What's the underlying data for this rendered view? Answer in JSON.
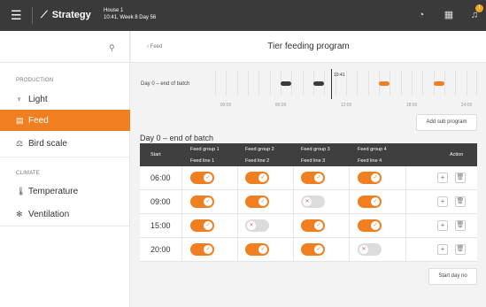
{
  "topbar": {
    "app_title": "Strategy",
    "house_line1": "House 1",
    "house_line2": "10:41, Week 8 Day 56",
    "menu_glyph": "☰",
    "chart_glyph": "⟋",
    "bell_badge": "!"
  },
  "sidebar": {
    "section_production": "PRODUCTION",
    "section_climate": "CLIMATE",
    "items": [
      {
        "label": "Light",
        "icon": "bulb-icon",
        "glyph": "♆"
      },
      {
        "label": "Feed",
        "icon": "feed-icon",
        "glyph": "▤",
        "active": true
      },
      {
        "label": "Bird scale",
        "icon": "scale-icon",
        "glyph": "⚖"
      },
      {
        "label": "Temperature",
        "icon": "thermometer-icon",
        "glyph": "🌡"
      },
      {
        "label": "Ventilation",
        "icon": "fan-icon",
        "glyph": "✻"
      }
    ]
  },
  "header": {
    "back_label": "‹ Feed",
    "title": "Tier feeding program"
  },
  "timeline": {
    "label": "Day 0 – end of batch",
    "now_label": "10:41",
    "axis": [
      "00:00",
      "06:00",
      "12:00",
      "18:00",
      "24:00"
    ]
  },
  "buttons": {
    "add_sub_program": "Add sub program",
    "start_day_no": "Start day no"
  },
  "table": {
    "title": "Day 0 – end of batch",
    "col_start": "Start",
    "col_action": "Action",
    "groups": [
      {
        "group": "Feed group 1",
        "line": "Feed line 1"
      },
      {
        "group": "Feed group 2",
        "line": "Feed line 2"
      },
      {
        "group": "Feed group 3",
        "line": "Feed line 3"
      },
      {
        "group": "Feed group 4",
        "line": "Feed line 4"
      }
    ],
    "rows": [
      {
        "start": "06:00",
        "states": [
          true,
          true,
          true,
          true
        ]
      },
      {
        "start": "09:00",
        "states": [
          true,
          true,
          false,
          true
        ]
      },
      {
        "start": "15:00",
        "states": [
          true,
          false,
          true,
          true
        ]
      },
      {
        "start": "20:00",
        "states": [
          true,
          true,
          true,
          false
        ]
      }
    ],
    "add_glyph": "+",
    "delete_glyph": "🗑"
  },
  "colors": {
    "accent": "#f07f22",
    "topbar": "#3a3a3a",
    "timeline_dark": "#3a3a3a",
    "toggle_off": "#dcdcdc"
  }
}
